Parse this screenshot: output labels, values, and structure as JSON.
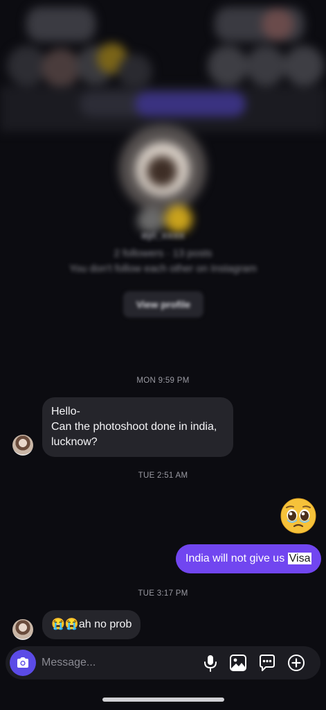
{
  "profile": {
    "name_blurred": "ayi_xxxx",
    "meta_blurred": "2 followers · 13 posts",
    "follow_note_blurred": "You don't follow each other on Instagram",
    "view_profile_label": "View profile"
  },
  "messages": [
    {
      "type": "timestamp",
      "text": "MON 9:59 PM"
    },
    {
      "type": "incoming",
      "lines": [
        "Hello-",
        "Can the photoshoot done in india,",
        "lucknow?"
      ]
    },
    {
      "type": "timestamp",
      "text": "TUE 2:51 AM"
    },
    {
      "type": "outgoing-emoji",
      "emoji": "🥹"
    },
    {
      "type": "outgoing",
      "text_before": "India will not give us ",
      "text_highlight": "Visa"
    },
    {
      "type": "timestamp",
      "text": "TUE 3:17 PM"
    },
    {
      "type": "incoming",
      "text": "😭😭ah no prob"
    }
  ],
  "composer": {
    "placeholder": "Message...",
    "icons": [
      "camera-icon",
      "microphone-icon",
      "gallery-icon",
      "sticker-icon",
      "plus-circle-icon"
    ]
  },
  "colors": {
    "background": "#0c0c11",
    "incoming_bubble": "#25252b",
    "outgoing_bubble": "#7146f0",
    "camera_button": "#5b4be6"
  }
}
